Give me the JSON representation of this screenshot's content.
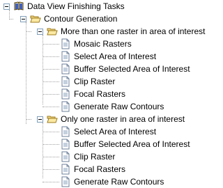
{
  "tree": {
    "root": {
      "label": "Data View Finishing Tasks",
      "icon": "book-icon",
      "expanded": true
    },
    "group": {
      "label": "Contour Generation",
      "icon": "open-folder-icon",
      "expanded": true
    },
    "folder_a": {
      "label": "More than one raster in area of interest",
      "icon": "open-folder-icon",
      "expanded": true,
      "items": [
        "Mosaic Rasters",
        "Select Area of Interest",
        "Buffer Selected Area of Interest",
        "Clip Raster",
        "Focal Rasters",
        "Generate Raw Contours"
      ]
    },
    "folder_b": {
      "label": "Only one raster in area of interest",
      "icon": "open-folder-icon",
      "expanded": true,
      "items": [
        "Select Area of Interest",
        "Buffer Selected Area of Interest",
        "Clip Raster",
        "Focal Rasters",
        "Generate Raw Contours"
      ]
    },
    "item_icon": "document-icon"
  }
}
